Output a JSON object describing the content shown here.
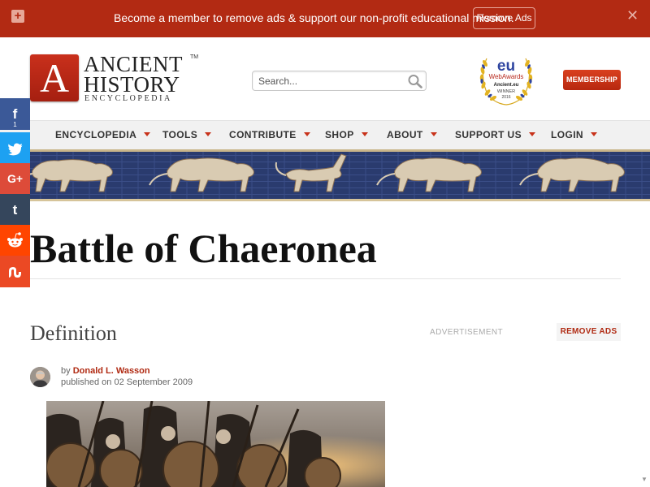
{
  "ad_bar": {
    "message": "Become a member to remove ads & support our non-profit educational mission.",
    "remove_ads_label": "Remove Ads",
    "close_glyph": "✕",
    "expand_glyph": "+"
  },
  "logo": {
    "letter": "A",
    "line1": "ANCIENT",
    "line2": "HISTORY",
    "line3": "ENCYCLOPEDIA",
    "trademark": "TM"
  },
  "search": {
    "placeholder": "Search..."
  },
  "award": {
    "big": "eu",
    "line1": "WebAwards",
    "line2": "Ancient.eu",
    "line3": "WINNER",
    "year": "2016"
  },
  "membership_label": "MEMBERSHIP",
  "nav": {
    "items": [
      {
        "label": "ENCYCLOPEDIA"
      },
      {
        "label": "TOOLS"
      },
      {
        "label": "CONTRIBUTE"
      },
      {
        "label": "SHOP"
      },
      {
        "label": "ABOUT"
      },
      {
        "label": "SUPPORT US"
      },
      {
        "label": "LOGIN"
      }
    ]
  },
  "social": {
    "facebook": {
      "glyph": "f",
      "count": "1",
      "color": "#3b5998"
    },
    "twitter": {
      "glyph": "🐦",
      "color": "#1da1f2"
    },
    "googleplus": {
      "glyph": "G+",
      "color": "#dd4b39"
    },
    "tumblr": {
      "glyph": "t",
      "color": "#35465c"
    },
    "reddit": {
      "glyph": "👽",
      "color": "#ff4500"
    },
    "stumbleupon": {
      "glyph": "Su",
      "color": "#eb4924"
    }
  },
  "article": {
    "title": "Battle of Chaeronea",
    "section_label": "Definition",
    "advertisement_label": "ADVERTISEMENT",
    "remove_ads_label": "REMOVE ADS",
    "by_prefix": "by",
    "author": "Donald L. Wasson",
    "published_prefix": "published on",
    "published_date": "02 September 2009"
  },
  "colors": {
    "brand_red": "#b22a13",
    "accent_red": "#c8321a",
    "nav_bg": "#f1f1f1",
    "banner_blue": "#2d3e74"
  }
}
